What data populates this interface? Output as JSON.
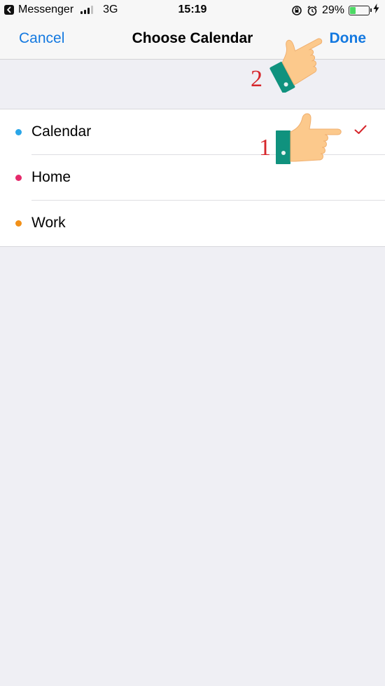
{
  "status_bar": {
    "back_app": "Messenger",
    "network": "3G",
    "time": "15:19",
    "battery_percent": "29%",
    "battery_level": 0.29,
    "battery_color": "#4cd964"
  },
  "navbar": {
    "cancel_label": "Cancel",
    "title": "Choose Calendar",
    "done_label": "Done",
    "accent_color": "#1479e0"
  },
  "calendars": [
    {
      "label": "Calendar",
      "color": "#2aa6e8",
      "selected": true
    },
    {
      "label": "Home",
      "color": "#e52a6b",
      "selected": false
    },
    {
      "label": "Work",
      "color": "#f29018",
      "selected": false
    }
  ],
  "annotations": {
    "step1": "1",
    "step2": "2",
    "hand_icon": "pointing-hand-icon"
  },
  "colors": {
    "background": "#efeff4",
    "checkmark": "#d6262b",
    "annotation_number": "#d6262b"
  }
}
